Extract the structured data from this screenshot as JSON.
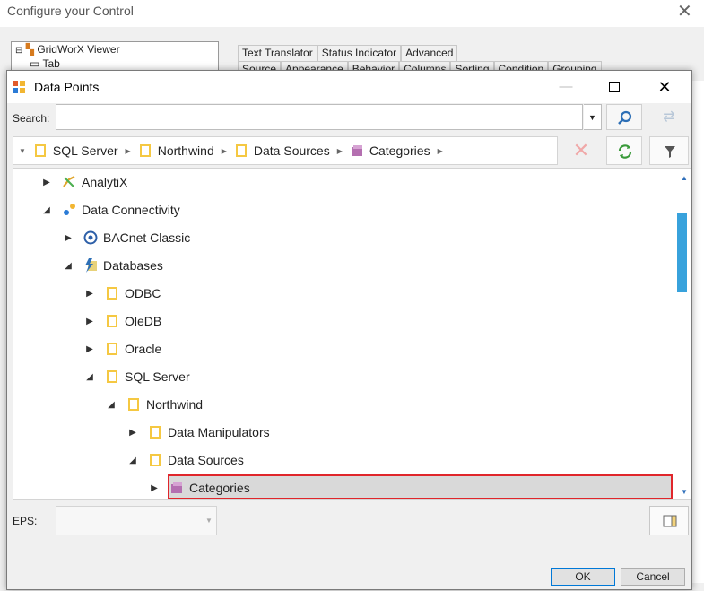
{
  "background": {
    "window_title": "Configure your Control",
    "tree_items": [
      "GridWorX Viewer",
      "Tab"
    ],
    "tabs_row1": [
      "Text Translator",
      "Status Indicator",
      "Advanced"
    ],
    "tabs_row2": [
      "Source",
      "Appearance",
      "Behavior",
      "Columns",
      "Sorting",
      "Condition",
      "Grouping"
    ]
  },
  "dialog": {
    "title": "Data Points",
    "search": {
      "label": "Search:",
      "value": ""
    },
    "breadcrumb": [
      "SQL Server",
      "Northwind",
      "Data Sources",
      "Categories"
    ],
    "tree": [
      {
        "label": "AnalytiX",
        "state": "collapsed",
        "icon": "analytix-icon"
      },
      {
        "label": "Data Connectivity",
        "state": "expanded",
        "icon": "data-connectivity-icon"
      },
      {
        "label": "BACnet Classic",
        "state": "collapsed",
        "icon": "bacnet-icon"
      },
      {
        "label": "Databases",
        "state": "expanded",
        "icon": "databases-icon"
      },
      {
        "label": "ODBC",
        "state": "collapsed",
        "icon": "folder-icon"
      },
      {
        "label": "OleDB",
        "state": "collapsed",
        "icon": "folder-icon"
      },
      {
        "label": "Oracle",
        "state": "collapsed",
        "icon": "folder-icon"
      },
      {
        "label": "SQL Server",
        "state": "expanded",
        "icon": "folder-icon"
      },
      {
        "label": "Northwind",
        "state": "expanded",
        "icon": "folder-icon"
      },
      {
        "label": "Data Manipulators",
        "state": "collapsed",
        "icon": "folder-icon"
      },
      {
        "label": "Data Sources",
        "state": "expanded",
        "icon": "folder-icon"
      },
      {
        "label": "Categories",
        "state": "collapsed",
        "icon": "data-source-icon",
        "selected": true
      }
    ],
    "eps": {
      "label": "EPS:",
      "value": ""
    },
    "ok_label": "OK",
    "cancel_label": "Cancel"
  },
  "colors": {
    "selection_border": "#e0262b",
    "scrollbar": "#38a2dc",
    "folder": "#f5c842"
  }
}
